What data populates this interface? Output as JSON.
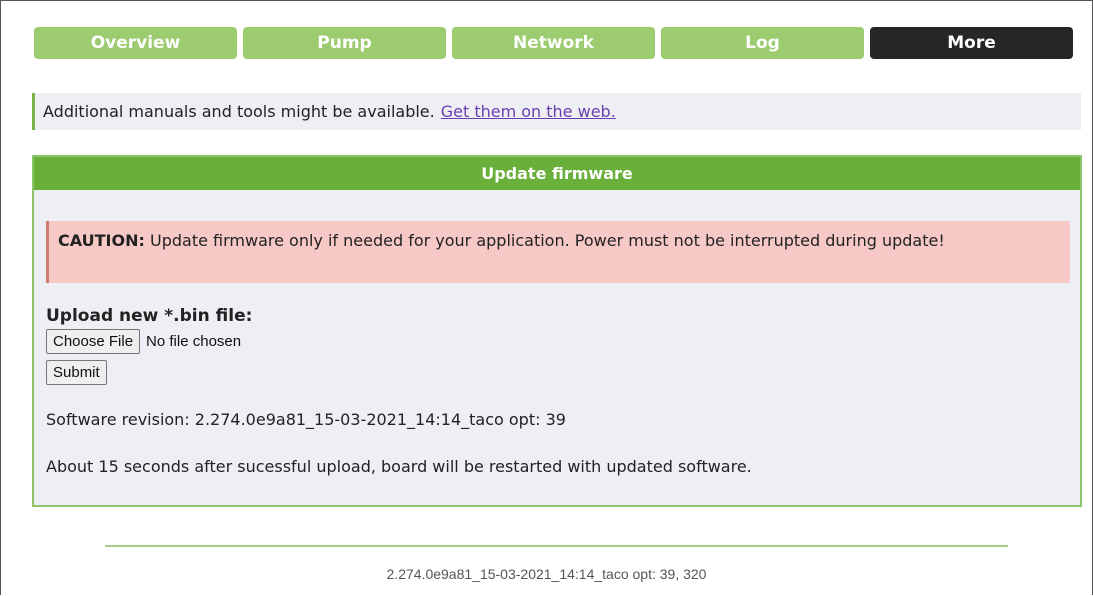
{
  "nav": {
    "tabs": [
      {
        "label": "Overview"
      },
      {
        "label": "Pump"
      },
      {
        "label": "Network"
      },
      {
        "label": "Log"
      },
      {
        "label": "More"
      }
    ],
    "active_tab": "More"
  },
  "info": {
    "text": "Additional manuals and tools might be available.",
    "link_text": "Get them on the web."
  },
  "panel": {
    "title": "Update firmware",
    "caution_label": "CAUTION:",
    "caution_text": "Update firmware only if needed for your application. Power must not be interrupted during update!",
    "upload_label": "Upload new *.bin file:",
    "choose_file_label": "Choose File",
    "file_status": "No file chosen",
    "submit_label": "Submit",
    "software_revision": "Software revision: 2.274.0e9a81_15-03-2021_14:14_taco opt: 39",
    "restart_note": "About 15 seconds after sucessful upload, board will be restarted with updated software."
  },
  "footer": {
    "version_text": "2.274.0e9a81_15-03-2021_14:14_taco opt: 39, 320"
  },
  "colors": {
    "tab_green": "#9ccc6f",
    "tab_active": "#262626",
    "header_green": "#6aaf3a",
    "caution_bg": "#f6c9c6",
    "panel_bg": "#eeeef5",
    "link": "#6a3fb0"
  }
}
